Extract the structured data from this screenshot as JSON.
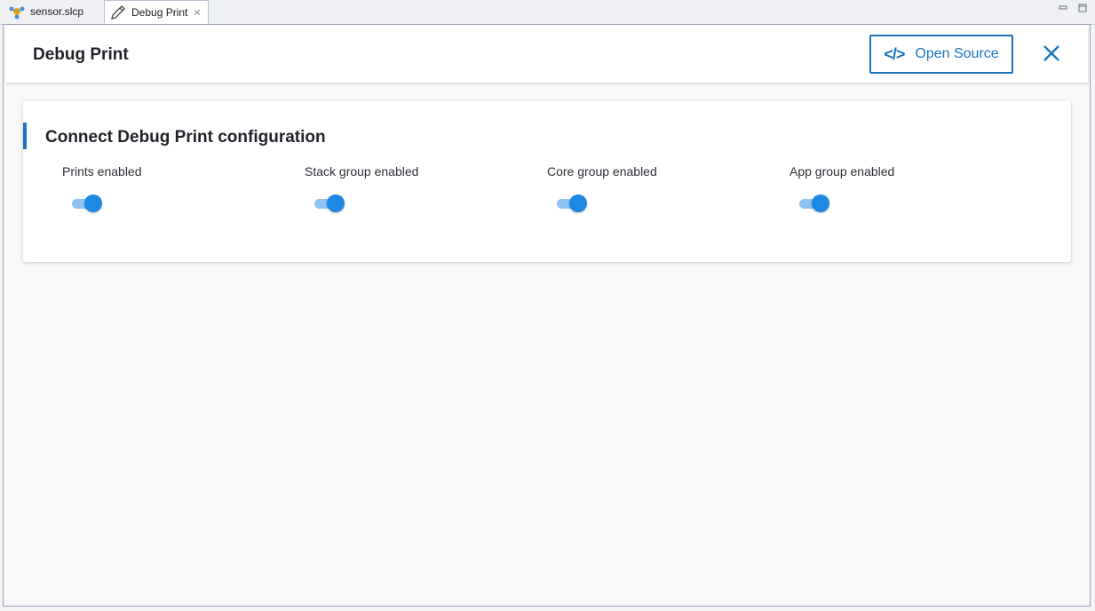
{
  "tabs": [
    {
      "label": "sensor.slcp",
      "icon": "component-icon",
      "active": false
    },
    {
      "label": "Debug Print",
      "icon": "pencil-icon",
      "active": true
    }
  ],
  "header": {
    "title": "Debug Print",
    "open_source_label": "Open Source",
    "close_icon": "close-icon"
  },
  "card": {
    "title": "Connect Debug Print configuration",
    "toggles": [
      {
        "label": "Prints enabled",
        "on": true
      },
      {
        "label": "Stack group enabled",
        "on": true
      },
      {
        "label": "Core group enabled",
        "on": true
      },
      {
        "label": "App group enabled",
        "on": true
      }
    ]
  },
  "colors": {
    "accent": "#1c75bc",
    "toggle_on": "#1e88e5",
    "toggle_track": "#8fc2f0"
  }
}
